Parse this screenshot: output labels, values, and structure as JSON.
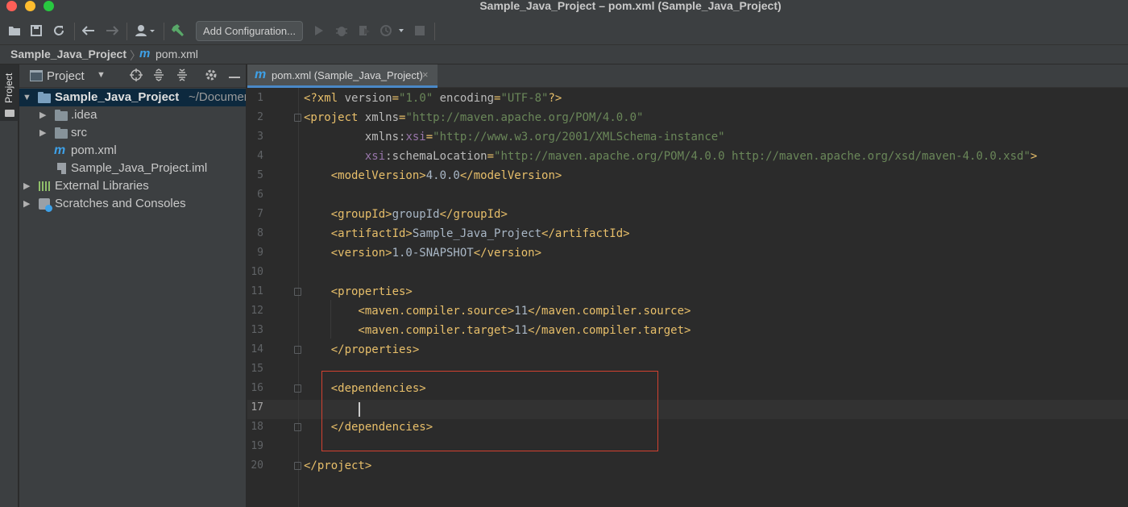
{
  "window": {
    "title": "Sample_Java_Project – pom.xml (Sample_Java_Project)"
  },
  "toolbar": {
    "add_configuration_label": "Add Configuration..."
  },
  "breadcrumb": {
    "project": "Sample_Java_Project",
    "separator": "〉",
    "file_icon": "m",
    "file": "pom.xml"
  },
  "side_stripe": {
    "project_tab_label": "Project"
  },
  "project_panel": {
    "title": "Project",
    "tree": [
      {
        "label": "Sample_Java_Project",
        "path": "~/Documents",
        "icon": "folder-icon",
        "expanded": true
      },
      {
        "label": ".idea",
        "icon": "folder-icon"
      },
      {
        "label": "src",
        "icon": "folder-icon"
      },
      {
        "label": "pom.xml",
        "icon": "maven-icon",
        "icon_text": "m"
      },
      {
        "label": "Sample_Java_Project.iml",
        "icon": "iml-file-icon"
      },
      {
        "label": "External Libraries",
        "icon": "libraries-icon"
      },
      {
        "label": "Scratches and Consoles",
        "icon": "scratches-icon"
      }
    ]
  },
  "editor_tab": {
    "icon": "m",
    "label": "pom.xml (Sample_Java_Project)",
    "close": "×"
  },
  "editor": {
    "current_line": 17,
    "lines": [
      {
        "n": "1",
        "tokens": [
          [
            "tag",
            "<?xml "
          ],
          [
            "attr",
            "version"
          ],
          [
            "tag",
            "="
          ],
          [
            "val",
            "\"1.0\""
          ],
          [
            "attr",
            " encoding"
          ],
          [
            "tag",
            "="
          ],
          [
            "val",
            "\"UTF-8\""
          ],
          [
            "tag",
            "?>"
          ]
        ]
      },
      {
        "n": "2",
        "tokens": [
          [
            "tag",
            "<project "
          ],
          [
            "attr",
            "xmlns"
          ],
          [
            "tag",
            "="
          ],
          [
            "val",
            "\"http://maven.apache.org/POM/4.0.0\""
          ]
        ]
      },
      {
        "n": "3",
        "tokens": [
          [
            "attr",
            "         xmlns:"
          ],
          [
            "ns",
            "xsi"
          ],
          [
            "tag",
            "="
          ],
          [
            "val",
            "\"http://www.w3.org/2001/XMLSchema-instance\""
          ]
        ]
      },
      {
        "n": "4",
        "tokens": [
          [
            "attr",
            "         "
          ],
          [
            "ns",
            "xsi"
          ],
          [
            "attr",
            ":schemaLocation"
          ],
          [
            "tag",
            "="
          ],
          [
            "val",
            "\"http://maven.apache.org/POM/4.0.0 http://maven.apache.org/xsd/maven-4.0.0.xsd\""
          ],
          [
            "tag",
            ">"
          ]
        ]
      },
      {
        "n": "5",
        "tokens": [
          [
            "tag",
            "    <modelVersion>"
          ],
          [
            "text",
            "4.0.0"
          ],
          [
            "tag",
            "</modelVersion>"
          ]
        ]
      },
      {
        "n": "6",
        "tokens": []
      },
      {
        "n": "7",
        "tokens": [
          [
            "tag",
            "    <groupId>"
          ],
          [
            "text",
            "groupId"
          ],
          [
            "tag",
            "</groupId>"
          ]
        ]
      },
      {
        "n": "8",
        "tokens": [
          [
            "tag",
            "    <artifactId>"
          ],
          [
            "text",
            "Sample_Java_Project"
          ],
          [
            "tag",
            "</artifactId>"
          ]
        ]
      },
      {
        "n": "9",
        "tokens": [
          [
            "tag",
            "    <version>"
          ],
          [
            "text",
            "1.0-SNAPSHOT"
          ],
          [
            "tag",
            "</version>"
          ]
        ]
      },
      {
        "n": "10",
        "tokens": []
      },
      {
        "n": "11",
        "tokens": [
          [
            "tag",
            "    <properties>"
          ]
        ]
      },
      {
        "n": "12",
        "tokens": [
          [
            "tag",
            "        <maven.compiler.source>"
          ],
          [
            "text",
            "11"
          ],
          [
            "tag",
            "</maven.compiler.source>"
          ]
        ]
      },
      {
        "n": "13",
        "tokens": [
          [
            "tag",
            "        <maven.compiler.target>"
          ],
          [
            "text",
            "11"
          ],
          [
            "tag",
            "</maven.compiler.target>"
          ]
        ]
      },
      {
        "n": "14",
        "tokens": [
          [
            "tag",
            "    </properties>"
          ]
        ]
      },
      {
        "n": "15",
        "tokens": []
      },
      {
        "n": "16",
        "tokens": [
          [
            "tag",
            "    <dependencies>"
          ]
        ]
      },
      {
        "n": "17",
        "tokens": []
      },
      {
        "n": "18",
        "tokens": [
          [
            "tag",
            "    </dependencies>"
          ]
        ]
      },
      {
        "n": "19",
        "tokens": []
      },
      {
        "n": "20",
        "tokens": [
          [
            "tag",
            "</project>"
          ]
        ]
      }
    ]
  },
  "colors": {
    "tag": "#e8bf6a",
    "attribute": "#bababa",
    "namespace": "#9876aa",
    "value": "#6a8759",
    "text": "#a9b7c6",
    "highlight_box": "#d24130",
    "selection": "#0d293e"
  }
}
